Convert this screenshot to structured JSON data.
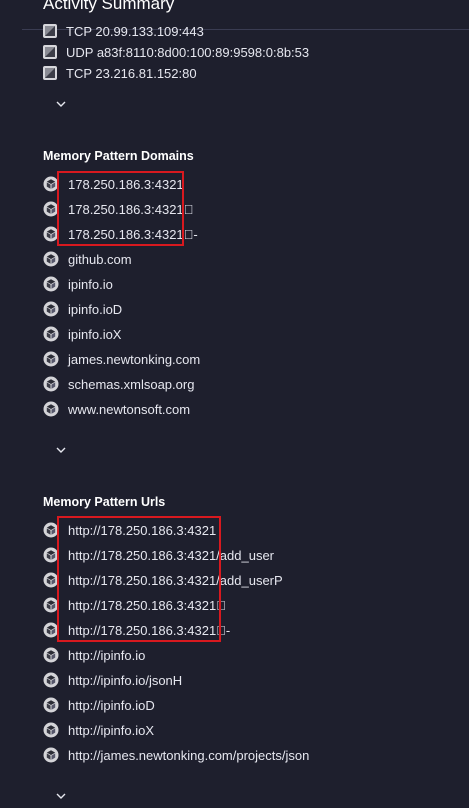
{
  "header": {
    "title": "Activity Summary"
  },
  "connections": {
    "items": [
      "TCP 20.99.133.109:443",
      "UDP a83f:8110:8d00:100:89:9598:0:8b:53",
      "TCP 23.216.81.152:80"
    ]
  },
  "domains": {
    "title": "Memory Pattern Domains",
    "items": [
      "178.250.186.3:4321",
      "178.250.186.3:4321\u0000",
      "178.250.186.3:4321\u0000-",
      "github.com",
      "ipinfo.io",
      "ipinfo.ioD",
      "ipinfo.ioX",
      "james.newtonking.com",
      "schemas.xmlsoap.org",
      "www.newtonsoft.com"
    ]
  },
  "urls": {
    "title": "Memory Pattern Urls",
    "items": [
      "http://178.250.186.3:4321",
      "http://178.250.186.3:4321/add_user",
      "http://178.250.186.3:4321/add_userP",
      "http://178.250.186.3:4321\u0000",
      "http://178.250.186.3:4321\u0000-",
      "http://ipinfo.io",
      "http://ipinfo.io/jsonH",
      "http://ipinfo.ioD",
      "http://ipinfo.ioX",
      "http://james.newtonking.com/projects/json"
    ]
  },
  "colors": {
    "background": "#1e1f2d",
    "text": "#e6e7ef",
    "highlight": "#d8191f"
  },
  "icons": {
    "connection": "network-icon",
    "pattern": "memory-pattern-icon",
    "expand": "chevron-down-icon"
  }
}
